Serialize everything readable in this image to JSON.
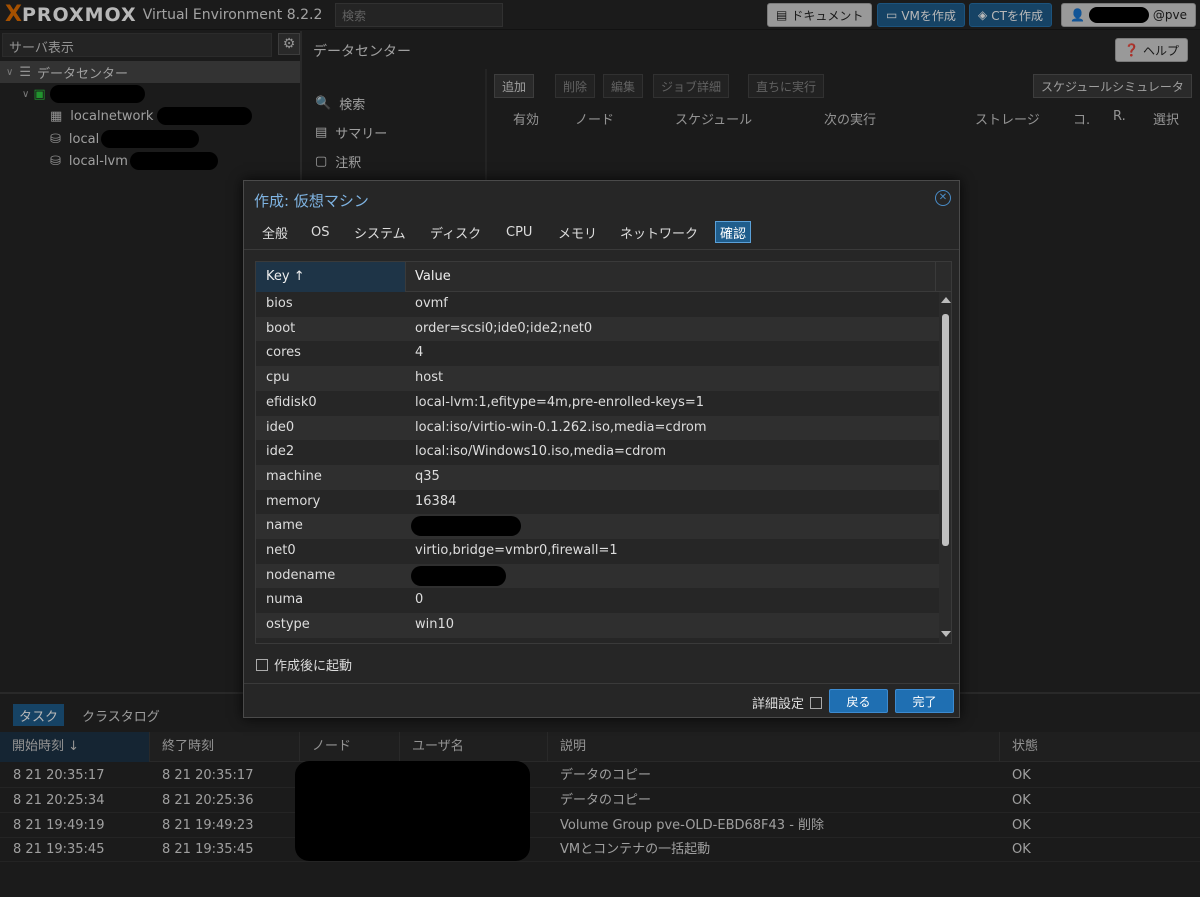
{
  "header": {
    "logo_x": "X",
    "logo_brand": "PROXMOX",
    "version": "Virtual Environment 8.2.2",
    "search_placeholder": "検索",
    "docs_label": "ドキュメント",
    "create_vm_label": "VMを作成",
    "create_ct_label": "CTを作成",
    "user_suffix": "@pve"
  },
  "sidebar": {
    "view_label": "サーバ表示",
    "tree": [
      {
        "label": "データセンター"
      },
      {
        "label": ""
      },
      {
        "label": "localnetwork"
      },
      {
        "label": "local"
      },
      {
        "label": "local-lvm"
      }
    ]
  },
  "main": {
    "title": "データセンター",
    "help_label": "ヘルプ",
    "nav": [
      "検索",
      "サマリー",
      "注釈"
    ],
    "toolbar": [
      "追加",
      "削除",
      "編集",
      "ジョブ詳細",
      "直ちに実行",
      "スケジュールシミュレータ"
    ],
    "columns": [
      "有効",
      "ノード",
      "スケジュール",
      "次の実行",
      "ストレージ",
      "コ.",
      "R.",
      "選択"
    ]
  },
  "dialog": {
    "title": "作成: 仮想マシン",
    "tabs": [
      "全般",
      "OS",
      "システム",
      "ディスク",
      "CPU",
      "メモリ",
      "ネットワーク",
      "確認"
    ],
    "active_tab": "確認",
    "grid_headers": {
      "key": "Key ↑",
      "value": "Value"
    },
    "rows": [
      {
        "key": "bios",
        "value": "ovmf"
      },
      {
        "key": "boot",
        "value": "order=scsi0;ide0;ide2;net0"
      },
      {
        "key": "cores",
        "value": "4"
      },
      {
        "key": "cpu",
        "value": "host"
      },
      {
        "key": "efidisk0",
        "value": "local-lvm:1,efitype=4m,pre-enrolled-keys=1"
      },
      {
        "key": "ide0",
        "value": "local:iso/virtio-win-0.1.262.iso,media=cdrom"
      },
      {
        "key": "ide2",
        "value": "local:iso/Windows10.iso,media=cdrom"
      },
      {
        "key": "machine",
        "value": "q35"
      },
      {
        "key": "memory",
        "value": "16384"
      },
      {
        "key": "name",
        "value": ""
      },
      {
        "key": "net0",
        "value": "virtio,bridge=vmbr0,firewall=1"
      },
      {
        "key": "nodename",
        "value": ""
      },
      {
        "key": "numa",
        "value": "0"
      },
      {
        "key": "ostype",
        "value": "win10"
      }
    ],
    "start_after_create": "作成後に起動",
    "advanced_label": "詳細設定",
    "back_label": "戻る",
    "finish_label": "完了"
  },
  "bottom": {
    "tabs": [
      "タスク",
      "クラスタログ"
    ],
    "headers": [
      "開始時刻 ↓",
      "終了時刻",
      "ノード",
      "ユーザ名",
      "説明",
      "状態"
    ],
    "rows": [
      {
        "start": "8 21 20:35:17",
        "end": "8 21 20:35:17",
        "desc": "データのコピー",
        "status": "OK"
      },
      {
        "start": "8 21 20:25:34",
        "end": "8 21 20:25:36",
        "desc": "データのコピー",
        "status": "OK"
      },
      {
        "start": "8 21 19:49:19",
        "end": "8 21 19:49:23",
        "desc": "Volume Group pve-OLD-EBD68F43 - 削除",
        "status": "OK"
      },
      {
        "start": "8 21 19:35:45",
        "end": "8 21 19:35:45",
        "desc": "VMとコンテナの一括起動",
        "status": "OK"
      }
    ]
  }
}
